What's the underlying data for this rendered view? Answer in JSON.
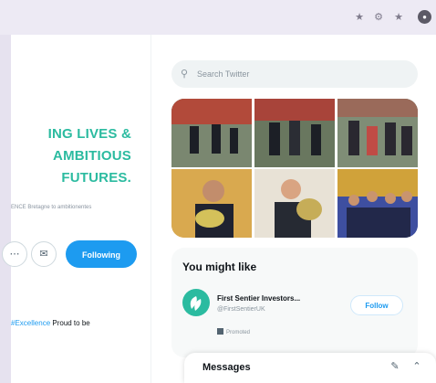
{
  "browser": {
    "icons": [
      "star-icon",
      "puzzle-icon",
      "extensions-icon"
    ],
    "avatar_icon": "profile-avatar-icon"
  },
  "profile": {
    "banner_lines": [
      "ING LIVES &",
      "AMBITIOUS",
      "FUTURES."
    ],
    "bio_fragment": "ENCE Bretagne to ambitionentes",
    "following_label": "Following",
    "buttons": [
      "more-icon",
      "notifications-icon"
    ]
  },
  "tweet": {
    "link_text": "#Excellence",
    "text": " Proud to be"
  },
  "search": {
    "placeholder": "Search Twitter"
  },
  "you_might_like": {
    "title": "You might like",
    "suggestion": {
      "name": "First Sentier Investors...",
      "handle": "@FirstSentierUK",
      "promoted_label": "Promoted",
      "follow_label": "Follow"
    }
  },
  "messages": {
    "title": "Messages"
  },
  "colors": {
    "accent": "#1d9bf0",
    "brand_teal": "#2bbba0"
  }
}
